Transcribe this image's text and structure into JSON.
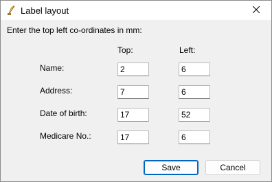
{
  "window": {
    "title": "Label layout",
    "icons": {
      "app": "feather-pen-icon",
      "close": "close-icon"
    }
  },
  "instruction": "Enter the top left co-ordinates in mm:",
  "columns": {
    "top": "Top:",
    "left": "Left:"
  },
  "rows": [
    {
      "label": "Name:",
      "top": "2",
      "left": "6"
    },
    {
      "label": "Address:",
      "top": "7",
      "left": "6"
    },
    {
      "label": "Date of birth:",
      "top": "17",
      "left": "52"
    },
    {
      "label": "Medicare No.:",
      "top": "17",
      "left": "6"
    }
  ],
  "buttons": {
    "save": "Save",
    "cancel": "Cancel"
  },
  "colors": {
    "accent": "#0067c0",
    "titlebar": "#ffffff",
    "dialog_bg": "#f0f0f0"
  }
}
